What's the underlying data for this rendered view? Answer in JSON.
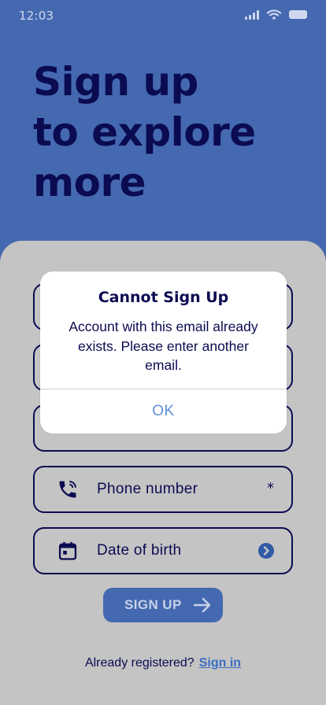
{
  "status_bar": {
    "time": "12:03",
    "icons": [
      "signal-icon",
      "wifi-icon",
      "battery-icon"
    ]
  },
  "hero": {
    "title_lines": [
      "Sign up",
      "to explore",
      "more"
    ]
  },
  "form": {
    "fields": [
      {
        "icon": "phone-icon",
        "label": "Phone number",
        "required_mark": "*"
      },
      {
        "icon": "calendar-icon",
        "label": "Date of birth",
        "trailing_icon": "chevron-right-circle-icon"
      }
    ],
    "submit_label": "SIGN UP",
    "submit_icon": "arrow-right-icon"
  },
  "footer": {
    "prompt": "Already registered?",
    "link_label": "Sign in"
  },
  "alert": {
    "title": "Cannot Sign Up",
    "message": "Account with this email already exists. Please enter another email.",
    "ok_label": "OK"
  },
  "colors": {
    "header_bg": "#4469b0",
    "sheet_bg": "#c4c4c4",
    "ink": "#0b0b52",
    "link": "#3a6ec4",
    "alert_action": "#5f8ed6"
  }
}
